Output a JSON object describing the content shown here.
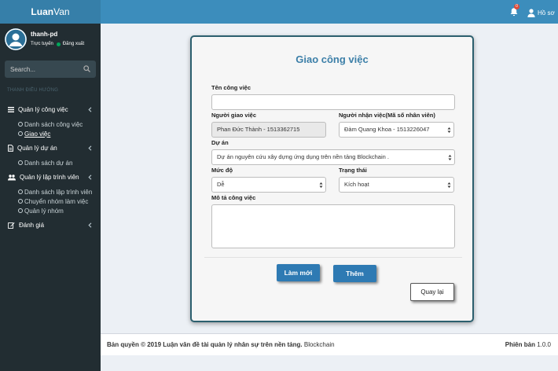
{
  "brand": {
    "bold": "Luan",
    "light": "Van"
  },
  "topbar": {
    "notification_count": "0",
    "profile_label": "Hồ sơ"
  },
  "user": {
    "name": "thanh-pd",
    "status": "Trực tuyến",
    "logout": "Đăng xuất"
  },
  "search": {
    "placeholder": "Search..."
  },
  "nav_header": "THANH ĐIỀU HƯỚNG",
  "menu": [
    {
      "label": "Quản lý công việc",
      "items": [
        "Danh sách công việc",
        "Giao việc"
      ]
    },
    {
      "label": "Quản lý dự án",
      "items": [
        "Danh sách dự án"
      ]
    },
    {
      "label": "Quản lý lập trình viên",
      "items": [
        "Danh sách lập trình viên",
        "Chuyển nhóm làm việc",
        "Quản lý nhóm"
      ]
    },
    {
      "label": "Đánh giá",
      "items": []
    }
  ],
  "form": {
    "title": "Giao công việc",
    "task_name_label": "Tên công việc",
    "task_name_value": "",
    "assigner_label": "Người giao việc",
    "assigner_value": "Phan Đức Thành - 1513362715",
    "assignee_label": "Người nhận việc(Mã số nhân viên)",
    "assignee_value": "Đàm Quang Khoa - 1513226047",
    "project_label": "Dự án",
    "project_value": "Dự án nguyên cứu xây dựng ứng dụng trên nền tảng Blockchain .",
    "level_label": "Mức độ",
    "level_value": "Dễ",
    "status_label": "Trạng thái",
    "status_value": "Kích hoạt",
    "desc_label": "Mô tả công việc",
    "desc_value": "",
    "reset_button": "Làm mới",
    "add_button": "Thêm",
    "back_button": "Quay lại"
  },
  "footer": {
    "copyright": "Bản quyền © 2019 Luận văn đề tài quản lý nhân sự trên nền tảng.",
    "copyright_tail": "Blockchain",
    "version_label": "Phiên bản",
    "version_value": "1.0.0"
  },
  "colors": {
    "header": "#3c8dbc",
    "logo": "#367fa9",
    "sidebar": "#222d32",
    "primary_button": "#2e7ab3",
    "title": "#3c7fa8"
  }
}
